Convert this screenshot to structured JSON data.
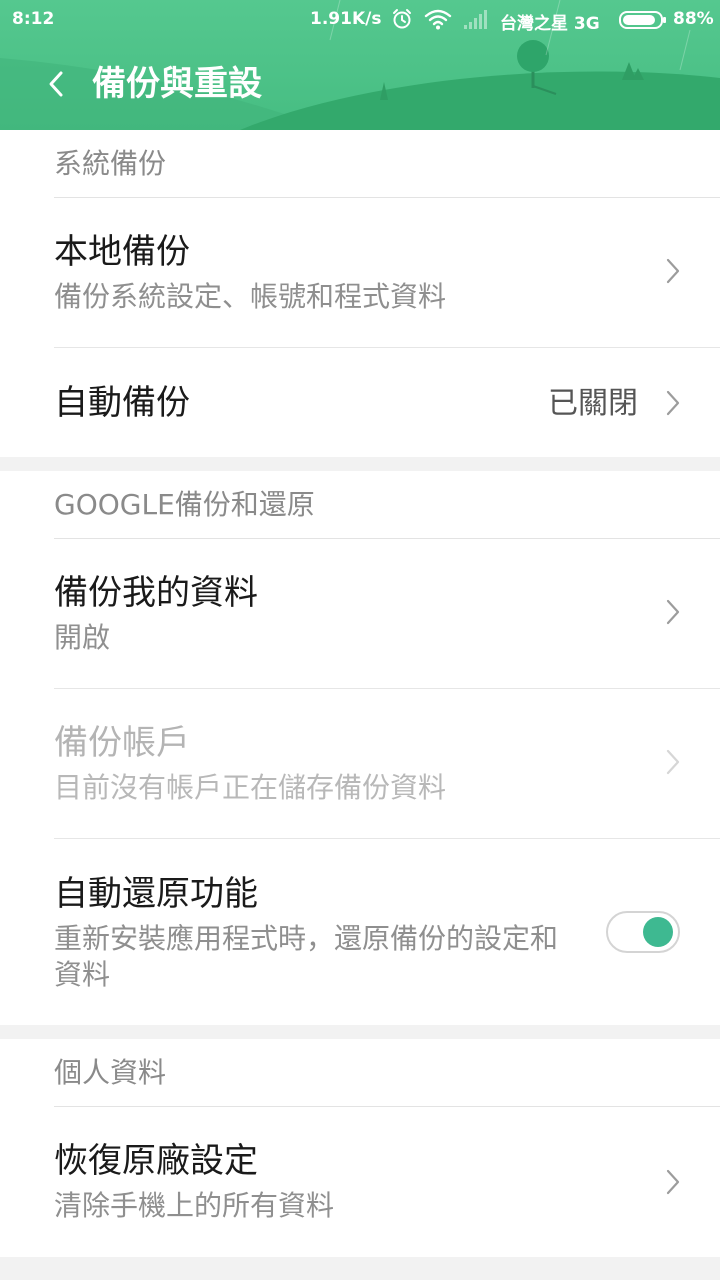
{
  "status_bar": {
    "time": "8:12",
    "network_speed": "1.91K/s",
    "carrier": "台灣之星 3G",
    "battery_percent": "88%",
    "battery_level": 0.88
  },
  "header": {
    "title": "備份與重設",
    "accent_color": "#4ec389"
  },
  "sections": [
    {
      "header": "系統備份",
      "items": [
        {
          "title": "本地備份",
          "subtitle": "備份系統設定、帳號和程式資料"
        },
        {
          "title": "自動備份",
          "value": "已關閉"
        }
      ]
    },
    {
      "header": "GOOGLE備份和還原",
      "items": [
        {
          "title": "備份我的資料",
          "subtitle": "開啟"
        },
        {
          "title": "備份帳戶",
          "subtitle": "目前沒有帳戶正在儲存備份資料",
          "enabled": false
        },
        {
          "title": "自動還原功能",
          "subtitle": "重新安裝應用程式時，還原備份的設定和資料",
          "toggle_on": true
        }
      ]
    },
    {
      "header": "個人資料",
      "items": [
        {
          "title": "恢復原廠設定",
          "subtitle": "清除手機上的所有資料"
        }
      ]
    }
  ],
  "icons": {
    "back": "chevron-left-icon",
    "chevron": "chevron-right-icon",
    "alarm": "alarm-icon",
    "wifi": "wifi-icon",
    "signal": "signal-icon",
    "battery": "battery-icon"
  },
  "colors": {
    "header_green": "#4ec389",
    "toggle_on": "#3eb991"
  }
}
